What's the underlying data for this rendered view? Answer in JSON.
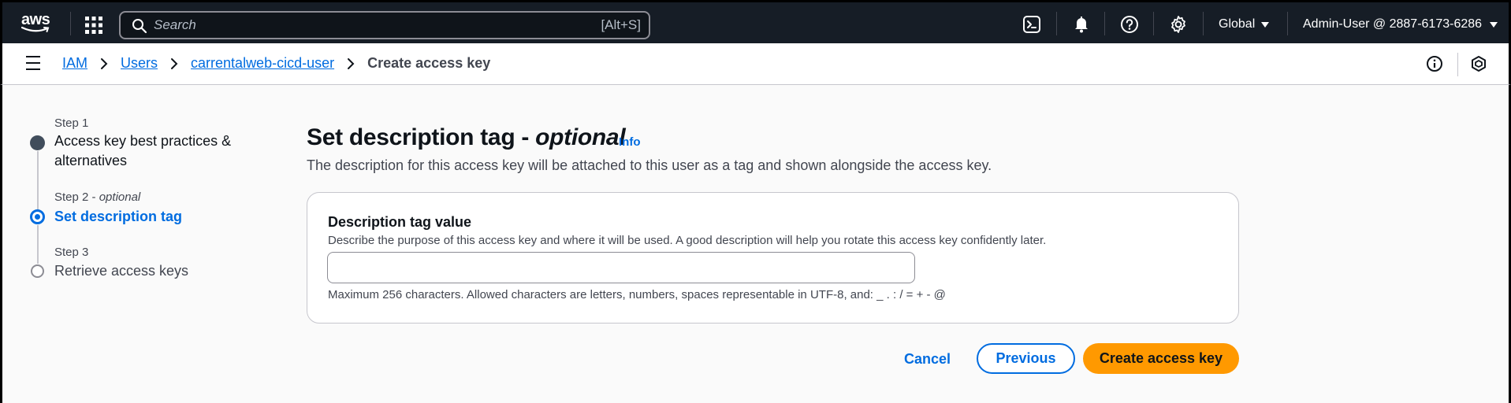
{
  "topnav": {
    "logo_text": "aws",
    "search_placeholder": "Search",
    "search_shortcut": "[Alt+S]",
    "region": "Global",
    "account": "Admin-User @ 2887-6173-6286",
    "colors": {
      "background": "#161d26",
      "text": "#ffffff"
    }
  },
  "breadcrumbs": {
    "items": [
      "IAM",
      "Users",
      "carrentalweb-cicd-user"
    ],
    "current": "Create access key"
  },
  "steps": [
    {
      "label": "Step 1",
      "title": "Access key best practices & alternatives",
      "state": "completed"
    },
    {
      "label": "Step 2",
      "label_suffix": "optional",
      "title": "Set description tag",
      "state": "active"
    },
    {
      "label": "Step 3",
      "title": "Retrieve access keys",
      "state": "pending"
    }
  ],
  "main": {
    "title": "Set description tag - ",
    "title_emphasis": "optional",
    "info_link": "Info",
    "description": "The description for this access key will be attached to this user as a tag and shown alongside the access key.",
    "field": {
      "label": "Description tag value",
      "description": "Describe the purpose of this access key and where it will be used. A good description will help you rotate this access key confidently later.",
      "value": "",
      "constraint": "Maximum 256 characters. Allowed characters are letters, numbers, spaces representable in UTF-8, and: _ . : / = + - @"
    }
  },
  "actions": {
    "cancel": "Cancel",
    "previous": "Previous",
    "create": "Create access key"
  },
  "colors": {
    "link": "#006ce0",
    "primary_button": "#ff9900",
    "active_step": "#006ce0"
  }
}
